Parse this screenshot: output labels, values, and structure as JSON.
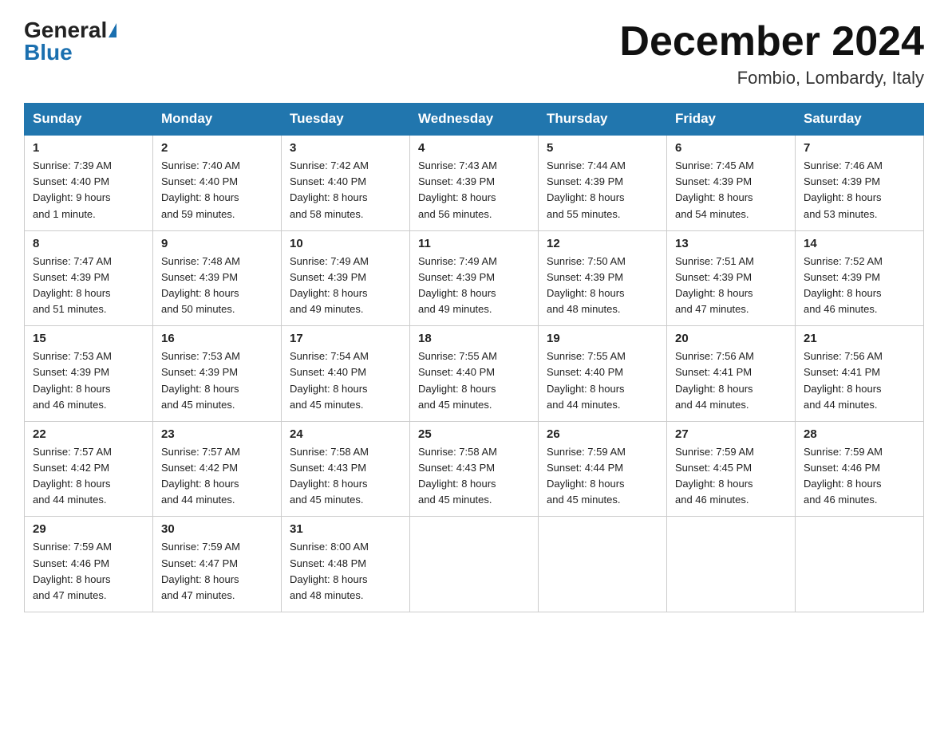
{
  "logo": {
    "general": "General",
    "blue": "Blue"
  },
  "title": {
    "month": "December 2024",
    "location": "Fombio, Lombardy, Italy"
  },
  "days_of_week": [
    "Sunday",
    "Monday",
    "Tuesday",
    "Wednesday",
    "Thursday",
    "Friday",
    "Saturday"
  ],
  "weeks": [
    [
      {
        "day": "1",
        "sunrise": "7:39 AM",
        "sunset": "4:40 PM",
        "daylight": "9 hours and 1 minute."
      },
      {
        "day": "2",
        "sunrise": "7:40 AM",
        "sunset": "4:40 PM",
        "daylight": "8 hours and 59 minutes."
      },
      {
        "day": "3",
        "sunrise": "7:42 AM",
        "sunset": "4:40 PM",
        "daylight": "8 hours and 58 minutes."
      },
      {
        "day": "4",
        "sunrise": "7:43 AM",
        "sunset": "4:39 PM",
        "daylight": "8 hours and 56 minutes."
      },
      {
        "day": "5",
        "sunrise": "7:44 AM",
        "sunset": "4:39 PM",
        "daylight": "8 hours and 55 minutes."
      },
      {
        "day": "6",
        "sunrise": "7:45 AM",
        "sunset": "4:39 PM",
        "daylight": "8 hours and 54 minutes."
      },
      {
        "day": "7",
        "sunrise": "7:46 AM",
        "sunset": "4:39 PM",
        "daylight": "8 hours and 53 minutes."
      }
    ],
    [
      {
        "day": "8",
        "sunrise": "7:47 AM",
        "sunset": "4:39 PM",
        "daylight": "8 hours and 51 minutes."
      },
      {
        "day": "9",
        "sunrise": "7:48 AM",
        "sunset": "4:39 PM",
        "daylight": "8 hours and 50 minutes."
      },
      {
        "day": "10",
        "sunrise": "7:49 AM",
        "sunset": "4:39 PM",
        "daylight": "8 hours and 49 minutes."
      },
      {
        "day": "11",
        "sunrise": "7:49 AM",
        "sunset": "4:39 PM",
        "daylight": "8 hours and 49 minutes."
      },
      {
        "day": "12",
        "sunrise": "7:50 AM",
        "sunset": "4:39 PM",
        "daylight": "8 hours and 48 minutes."
      },
      {
        "day": "13",
        "sunrise": "7:51 AM",
        "sunset": "4:39 PM",
        "daylight": "8 hours and 47 minutes."
      },
      {
        "day": "14",
        "sunrise": "7:52 AM",
        "sunset": "4:39 PM",
        "daylight": "8 hours and 46 minutes."
      }
    ],
    [
      {
        "day": "15",
        "sunrise": "7:53 AM",
        "sunset": "4:39 PM",
        "daylight": "8 hours and 46 minutes."
      },
      {
        "day": "16",
        "sunrise": "7:53 AM",
        "sunset": "4:39 PM",
        "daylight": "8 hours and 45 minutes."
      },
      {
        "day": "17",
        "sunrise": "7:54 AM",
        "sunset": "4:40 PM",
        "daylight": "8 hours and 45 minutes."
      },
      {
        "day": "18",
        "sunrise": "7:55 AM",
        "sunset": "4:40 PM",
        "daylight": "8 hours and 45 minutes."
      },
      {
        "day": "19",
        "sunrise": "7:55 AM",
        "sunset": "4:40 PM",
        "daylight": "8 hours and 44 minutes."
      },
      {
        "day": "20",
        "sunrise": "7:56 AM",
        "sunset": "4:41 PM",
        "daylight": "8 hours and 44 minutes."
      },
      {
        "day": "21",
        "sunrise": "7:56 AM",
        "sunset": "4:41 PM",
        "daylight": "8 hours and 44 minutes."
      }
    ],
    [
      {
        "day": "22",
        "sunrise": "7:57 AM",
        "sunset": "4:42 PM",
        "daylight": "8 hours and 44 minutes."
      },
      {
        "day": "23",
        "sunrise": "7:57 AM",
        "sunset": "4:42 PM",
        "daylight": "8 hours and 44 minutes."
      },
      {
        "day": "24",
        "sunrise": "7:58 AM",
        "sunset": "4:43 PM",
        "daylight": "8 hours and 45 minutes."
      },
      {
        "day": "25",
        "sunrise": "7:58 AM",
        "sunset": "4:43 PM",
        "daylight": "8 hours and 45 minutes."
      },
      {
        "day": "26",
        "sunrise": "7:59 AM",
        "sunset": "4:44 PM",
        "daylight": "8 hours and 45 minutes."
      },
      {
        "day": "27",
        "sunrise": "7:59 AM",
        "sunset": "4:45 PM",
        "daylight": "8 hours and 46 minutes."
      },
      {
        "day": "28",
        "sunrise": "7:59 AM",
        "sunset": "4:46 PM",
        "daylight": "8 hours and 46 minutes."
      }
    ],
    [
      {
        "day": "29",
        "sunrise": "7:59 AM",
        "sunset": "4:46 PM",
        "daylight": "8 hours and 47 minutes."
      },
      {
        "day": "30",
        "sunrise": "7:59 AM",
        "sunset": "4:47 PM",
        "daylight": "8 hours and 47 minutes."
      },
      {
        "day": "31",
        "sunrise": "8:00 AM",
        "sunset": "4:48 PM",
        "daylight": "8 hours and 48 minutes."
      },
      null,
      null,
      null,
      null
    ]
  ]
}
